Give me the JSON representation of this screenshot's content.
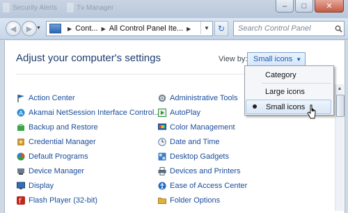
{
  "window": {
    "background_titles": [
      "Security Alerts",
      "Tv Manager"
    ]
  },
  "nav": {
    "back_icon": "back-arrow-icon",
    "forward_icon": "forward-arrow-icon",
    "breadcrumbs": [
      "Cont...",
      "All Control Panel Ite..."
    ],
    "search_placeholder": "Search Control Panel"
  },
  "main": {
    "title": "Adjust your computer's settings",
    "view_by_label": "View by:",
    "view_by_value": "Small icons"
  },
  "items_left": [
    {
      "label": "Action Center",
      "icon": "flag-icon",
      "color": "#1f5fb5"
    },
    {
      "label": "Akamai NetSession Interface Control...",
      "icon": "akamai-icon",
      "color": "#2c8fd6"
    },
    {
      "label": "Backup and Restore",
      "icon": "backup-icon",
      "color": "#3aa54a"
    },
    {
      "label": "Credential Manager",
      "icon": "vault-icon",
      "color": "#c7922e"
    },
    {
      "label": "Default Programs",
      "icon": "default-programs-icon",
      "color": "#3f9a3f"
    },
    {
      "label": "Device Manager",
      "icon": "device-manager-icon",
      "color": "#6b7a8c"
    },
    {
      "label": "Display",
      "icon": "display-icon",
      "color": "#2f6fbf"
    },
    {
      "label": "Flash Player (32-bit)",
      "icon": "flash-icon",
      "color": "#c0281c"
    }
  ],
  "items_right": [
    {
      "label": "Administrative Tools",
      "icon": "admin-tools-icon",
      "color": "#7a8896"
    },
    {
      "label": "AutoPlay",
      "icon": "autoplay-icon",
      "color": "#2f8d3a"
    },
    {
      "label": "Color Management",
      "icon": "color-management-icon",
      "color": "#2a6db5"
    },
    {
      "label": "Date and Time",
      "icon": "clock-icon",
      "color": "#5c7fa8"
    },
    {
      "label": "Desktop Gadgets",
      "icon": "gadgets-icon",
      "color": "#3c7fc8"
    },
    {
      "label": "Devices and Printers",
      "icon": "printer-icon",
      "color": "#5a6a7a"
    },
    {
      "label": "Ease of Access Center",
      "icon": "accessibility-icon",
      "color": "#2067c3"
    },
    {
      "label": "Folder Options",
      "icon": "folder-icon",
      "color": "#e0b23a"
    }
  ],
  "dropdown": {
    "options": [
      "Category",
      "Large icons",
      "Small icons"
    ],
    "selected": "Small icons"
  },
  "colors": {
    "link": "#1a4c9a",
    "title": "#1e3b6e"
  }
}
